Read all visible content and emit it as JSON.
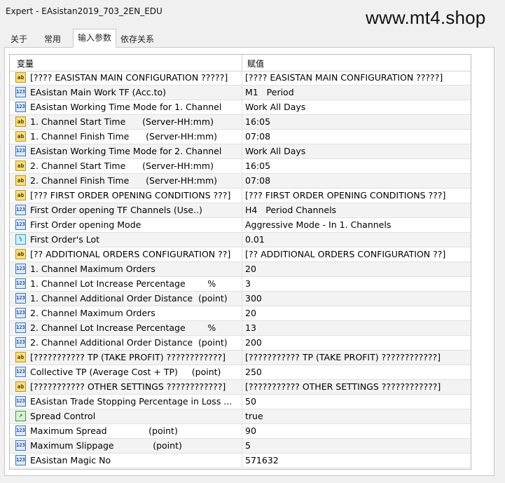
{
  "window": {
    "title": "Expert - EAsistan2019_703_2EN_EDU"
  },
  "watermark": "www.mt4.shop",
  "tabs": [
    {
      "label": "关于"
    },
    {
      "label": "常用"
    },
    {
      "label": "输入参数"
    },
    {
      "label": "依存关系"
    }
  ],
  "grid": {
    "col_variable": "变量",
    "col_value": "赋值",
    "rows": [
      {
        "type": "ab",
        "name": "[???? EASISTAN MAIN CONFIGURATION ?????]",
        "value": "[???? EASISTAN MAIN CONFIGURATION ?????]"
      },
      {
        "type": "num",
        "name": "EAsistan Main Work TF (Acc.to)",
        "value": "M1   Period"
      },
      {
        "type": "num",
        "name": "EAsistan Working Time Mode for 1. Channel",
        "value": "Work All Days"
      },
      {
        "type": "ab",
        "name": "1. Channel Start Time      (Server-HH:mm)",
        "value": "16:05"
      },
      {
        "type": "ab",
        "name": "1. Channel Finish Time      (Server-HH:mm)",
        "value": "07:08"
      },
      {
        "type": "num",
        "name": "EAsistan Working Time Mode for 2. Channel",
        "value": "Work All Days"
      },
      {
        "type": "ab",
        "name": "2. Channel Start Time      (Server-HH:mm)",
        "value": "16:05"
      },
      {
        "type": "ab",
        "name": "2. Channel Finish Time      (Server-HH:mm)",
        "value": "07:08"
      },
      {
        "type": "ab",
        "name": "[??? FIRST ORDER OPENING CONDITIONS ???]",
        "value": "[??? FIRST ORDER OPENING CONDITIONS ???]"
      },
      {
        "type": "num",
        "name": "First Order opening TF Channels (Use..)",
        "value": "H4   Period Channels"
      },
      {
        "type": "num",
        "name": "First Order opening Mode",
        "value": "Aggressive Mode - In 1. Channels"
      },
      {
        "type": "dbl",
        "name": "First Order's Lot",
        "value": "0.01"
      },
      {
        "type": "ab",
        "name": "[?? ADDITIONAL ORDERS CONFIGURATION ??]",
        "value": "[?? ADDITIONAL ORDERS CONFIGURATION ??]"
      },
      {
        "type": "num",
        "name": "1. Channel Maximum Orders",
        "value": "20"
      },
      {
        "type": "num",
        "name": "1. Channel Lot Increase Percentage        %",
        "value": "3"
      },
      {
        "type": "num",
        "name": "1. Channel Additional Order Distance  (point)",
        "value": "300"
      },
      {
        "type": "num",
        "name": "2. Channel Maximum Orders",
        "value": "20"
      },
      {
        "type": "num",
        "name": "2. Channel Lot Increase Percentage        %",
        "value": "13"
      },
      {
        "type": "num",
        "name": "2. Channel Additional Order Distance  (point)",
        "value": "200"
      },
      {
        "type": "ab",
        "name": "[??????????? TP (TAKE PROFIT) ????????????]",
        "value": "[??????????? TP (TAKE PROFIT) ????????????]"
      },
      {
        "type": "num",
        "name": "Collective TP (Average Cost + TP)     (point)",
        "value": "250"
      },
      {
        "type": "ab",
        "name": "[??????????? OTHER SETTINGS ????????????]",
        "value": "[??????????? OTHER SETTINGS ????????????]"
      },
      {
        "type": "num",
        "name": "EAsistan Trade Stopping Percentage in Loss ...",
        "value": "50"
      },
      {
        "type": "bool",
        "name": "Spread Control",
        "value": "true"
      },
      {
        "type": "num",
        "name": "Maximum Spread               (point)",
        "value": "90"
      },
      {
        "type": "num",
        "name": "Maximum Slippage              (point)",
        "value": "5"
      },
      {
        "type": "num",
        "name": "EAsistan Magic No",
        "value": "571632"
      }
    ]
  },
  "icons": {
    "ab": "string-type-icon",
    "num": "integer-type-icon",
    "dbl": "double-type-icon",
    "bool": "bool-type-icon"
  },
  "icon_text": {
    "ab": "ab",
    "num": "123",
    "dbl": "½",
    "bool": "↗"
  }
}
